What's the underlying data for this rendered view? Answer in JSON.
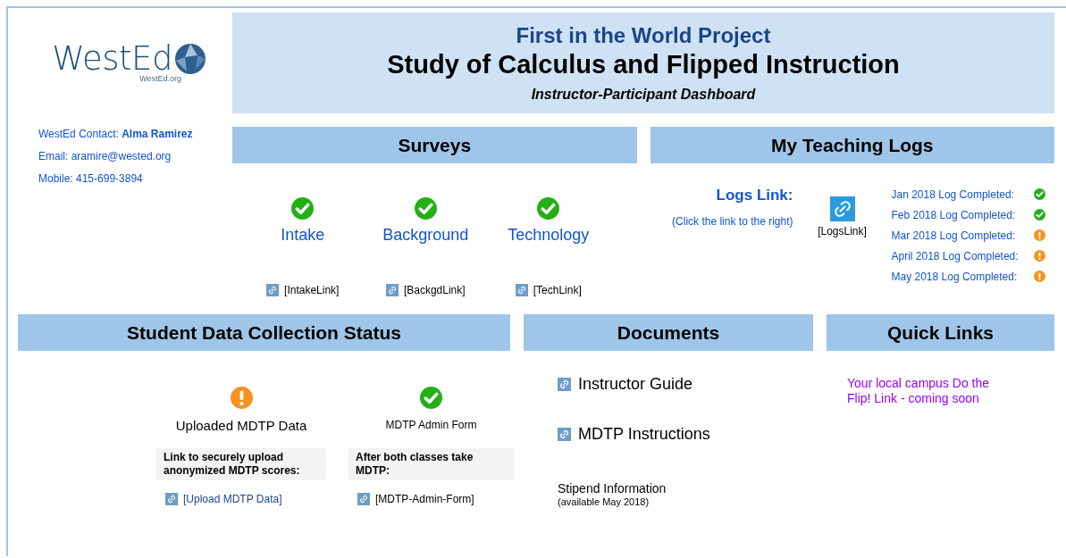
{
  "logo": {
    "name": "WestEd",
    "url": "WestEd.org"
  },
  "contact": [
    "WestEd Contact: **Alma Ramirez**",
    "Email: aramire@wested.org",
    "Mobile: 415-699-3894"
  ],
  "header": {
    "project": "First in the World Project",
    "title": "Study of Calculus and Flipped Instruction",
    "subtitle": "Instructor-Participant Dashboard"
  },
  "surveys": {
    "heading": "Surveys",
    "items": [
      {
        "label": "Intake",
        "completed": true,
        "link": "[IntakeLink]"
      },
      {
        "label": "Background",
        "completed": true,
        "link": "[BackgdLink]"
      },
      {
        "label": "Technology",
        "completed": true,
        "link": "[TechLink]"
      }
    ]
  },
  "teaching_logs": {
    "heading": "My Teaching Logs",
    "link_title": "Logs Link:",
    "link_hint": "(Click the link to the right)",
    "link": "[LogsLink]",
    "logs": [
      {
        "label": "Jan 2018 Log Completed:",
        "completed": true
      },
      {
        "label": "Feb 2018 Log Completed:",
        "completed": true
      },
      {
        "label": "Mar 2018 Log Completed:",
        "completed": false
      },
      {
        "label": "April 2018 Log Completed:",
        "completed": false
      },
      {
        "label": "May 2018 Log Completed:",
        "completed": false
      }
    ]
  },
  "student_data": {
    "heading": "Student Data Collection Status",
    "items": [
      {
        "label": "Uploaded MDTP Data",
        "completed": false,
        "note": "Link to securely upload anonymized MDTP scores:",
        "link": "[Upload MDTP Data]"
      },
      {
        "label": "MDTP Admin Form",
        "completed": true,
        "note": "After both classes take MDTP:",
        "link": "[MDTP-Admin-Form]"
      }
    ]
  },
  "documents": {
    "heading": "Documents",
    "links": [
      "Instructor Guide",
      "MDTP Instructions"
    ],
    "note": {
      "title": "Stipend Information",
      "subtitle": "(available May 2018)"
    }
  },
  "quick_links": {
    "heading": "Quick Links",
    "text": "Your local campus Do the Flip! Link - coming soon"
  }
}
